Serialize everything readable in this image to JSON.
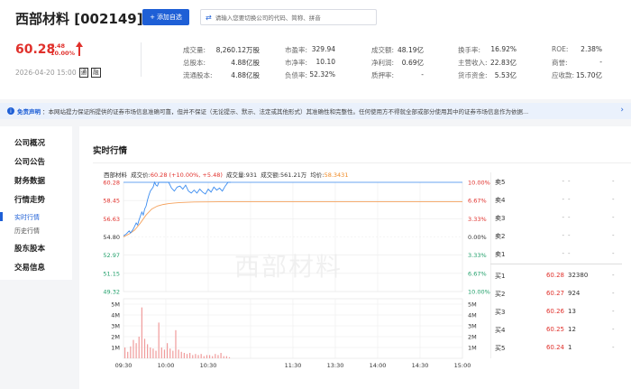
{
  "header": {
    "stock_title": "西部材料 [002149]",
    "add_button": "添加自选",
    "search_placeholder": "请输入您要切换公司的代码、简称、拼音",
    "price": "60.28",
    "change_amount": "5.48",
    "change_percent": "10.00%",
    "datetime": "2026-04-20 15:00",
    "tag_tong": "通",
    "tag_rong": "融"
  },
  "metrics": [
    {
      "label": "成交量:",
      "value": "8,260.12万股"
    },
    {
      "label": "市盈率:",
      "value": "329.94"
    },
    {
      "label": "成交额:",
      "value": "48.19亿"
    },
    {
      "label": "换手率:",
      "value": "16.92%"
    },
    {
      "label": "ROE:",
      "value": "2.38%"
    },
    {
      "label": "总股本:",
      "value": "4.88亿股"
    },
    {
      "label": "市净率:",
      "value": "10.10"
    },
    {
      "label": "净利润:",
      "value": "0.69亿"
    },
    {
      "label": "主营收入:",
      "value": "22.83亿"
    },
    {
      "label": "商誉:",
      "value": "-"
    },
    {
      "label": "流通股本:",
      "value": "4.88亿股"
    },
    {
      "label": "负债率:",
      "value": "52.32%"
    },
    {
      "label": "质押率:",
      "value": "-"
    },
    {
      "label": "货币资金:",
      "value": "5.53亿"
    },
    {
      "label": "应收款:",
      "value": "15.70亿"
    }
  ],
  "notice": {
    "title": "免责声明",
    "text": "：本网站提力保证所提供的证券市场信息准确可靠，但并不保证（无论提示、默示、法定或其他形式）其准确性和完整性。任何使用方不得就全部或部分使用其中的证券市场信息作为依据..."
  },
  "sidebar": {
    "company_overview": "公司概况",
    "company_notice": "公司公告",
    "financial_data": "财务数据",
    "market_trend": "行情走势",
    "realtime": "实时行情",
    "history": "历史行情",
    "shareholders": "股东股本",
    "trade_info": "交易信息"
  },
  "main": {
    "section_title": "实时行情",
    "watermark": "西部材料",
    "info_name": "西部材料",
    "info_price_label": "成交价:",
    "info_price": "60.28 (+10.00%, +5.48)",
    "info_vol_label": "成交量:",
    "info_vol": "931",
    "info_amt_label": "成交额:",
    "info_amt": "561.21万",
    "info_avg_label": "均价:",
    "info_avg": "58.3431"
  },
  "chart_data": {
    "type": "line",
    "price_ticks_left": [
      "60.28",
      "58.45",
      "56.63",
      "54.80",
      "52.97",
      "51.15",
      "49.32"
    ],
    "price_tick_values": [
      60.28,
      58.45,
      56.63,
      54.8,
      52.97,
      51.15,
      49.32
    ],
    "pct_ticks_right": [
      "10.00%",
      "6.67%",
      "3.33%",
      "0.00%",
      "3.33%",
      "6.67%",
      "10.00%"
    ],
    "ylim": [
      49.32,
      60.28
    ],
    "prev_close": 54.8,
    "vol_ticks_left": [
      "5M",
      "4M",
      "3M",
      "2M",
      "1M"
    ],
    "vol_ticks_right": [
      "5M",
      "4M",
      "3M",
      "2M",
      "1M"
    ],
    "vol_tick_values": [
      5,
      4,
      3,
      2,
      1
    ],
    "vol_max": 5.5,
    "x_ticks": [
      "09:30",
      "10:00",
      "10:30",
      "11:30",
      "13:30",
      "14:00",
      "14:30",
      "15:00"
    ],
    "x_tick_minutes": [
      0,
      30,
      60,
      120,
      150,
      180,
      210,
      240
    ],
    "x_ticks_trading": [
      0,
      30,
      60,
      90,
      120,
      150,
      180,
      210,
      240
    ],
    "price_series": {
      "minutes": [
        0,
        2,
        4,
        5,
        7,
        8,
        9,
        10,
        11,
        12,
        13,
        14,
        15,
        16,
        17,
        18,
        19,
        20,
        21,
        22,
        23,
        24,
        25,
        26,
        27,
        28,
        29,
        30,
        32,
        34,
        36,
        38,
        40,
        42,
        44,
        46,
        48,
        50,
        52,
        54,
        56,
        58,
        60,
        62,
        64,
        66,
        68,
        70,
        72,
        74,
        76
      ],
      "values": [
        54.9,
        55.1,
        55.4,
        55.2,
        55.6,
        55.9,
        56.2,
        56.0,
        56.5,
        56.9,
        57.3,
        57.0,
        57.6,
        57.9,
        58.5,
        59.0,
        59.4,
        59.6,
        59.8,
        60.28,
        60.0,
        59.9,
        60.28,
        60.28,
        60.28,
        60.28,
        60.28,
        60.28,
        60.28,
        59.7,
        59.4,
        59.8,
        59.9,
        59.6,
        60.0,
        59.4,
        59.2,
        59.5,
        59.2,
        59.6,
        59.3,
        59.1,
        59.6,
        59.3,
        59.8,
        59.5,
        59.7,
        59.4,
        59.9,
        60.28,
        60.28
      ]
    },
    "avg_series": {
      "minutes": [
        0,
        4,
        8,
        12,
        16,
        20,
        24,
        28,
        32,
        36,
        40,
        50,
        60,
        80,
        100,
        140,
        180,
        240
      ],
      "values": [
        54.8,
        55.1,
        55.5,
        56.2,
        57.0,
        57.6,
        57.9,
        58.05,
        58.15,
        58.2,
        58.25,
        58.3,
        58.32,
        58.34,
        58.34,
        58.34,
        58.34,
        58.34
      ]
    },
    "volume_series": {
      "minutes": [
        1,
        3,
        5,
        7,
        9,
        11,
        13,
        15,
        17,
        19,
        21,
        23,
        25,
        27,
        29,
        31,
        33,
        35,
        37,
        39,
        41,
        43,
        45,
        47,
        49,
        51,
        53,
        55,
        57,
        59,
        61,
        63,
        65,
        67,
        69,
        71,
        73,
        75
      ],
      "values": [
        1.0,
        0.6,
        1.1,
        1.7,
        1.4,
        2.0,
        4.7,
        1.8,
        1.3,
        1.0,
        0.9,
        0.7,
        3.3,
        1.0,
        0.8,
        1.4,
        0.9,
        0.7,
        2.6,
        0.8,
        0.6,
        0.5,
        0.4,
        0.5,
        0.3,
        0.4,
        0.3,
        0.4,
        0.2,
        0.3,
        0.3,
        0.2,
        0.4,
        0.3,
        0.5,
        0.2,
        0.2,
        0.1
      ]
    },
    "colors": {
      "price": "#3b8cf0",
      "avg": "#f5a25d",
      "limit": "#3b8cf0",
      "vol": "#f09b9b"
    }
  },
  "orderbook": {
    "asks": [
      {
        "label": "卖5",
        "price": "-",
        "vol": "-",
        "ch": "-"
      },
      {
        "label": "卖4",
        "price": "-",
        "vol": "-",
        "ch": "-"
      },
      {
        "label": "卖3",
        "price": "-",
        "vol": "-",
        "ch": "-"
      },
      {
        "label": "卖2",
        "price": "-",
        "vol": "-",
        "ch": "-"
      },
      {
        "label": "卖1",
        "price": "-",
        "vol": "-",
        "ch": "-"
      }
    ],
    "bids": [
      {
        "label": "买1",
        "price": "60.28",
        "vol": "32380",
        "ch": "-"
      },
      {
        "label": "买2",
        "price": "60.27",
        "vol": "924",
        "ch": "-"
      },
      {
        "label": "买3",
        "price": "60.26",
        "vol": "13",
        "ch": "-"
      },
      {
        "label": "买4",
        "price": "60.25",
        "vol": "12",
        "ch": "-"
      },
      {
        "label": "买5",
        "price": "60.24",
        "vol": "1",
        "ch": "-"
      }
    ]
  }
}
